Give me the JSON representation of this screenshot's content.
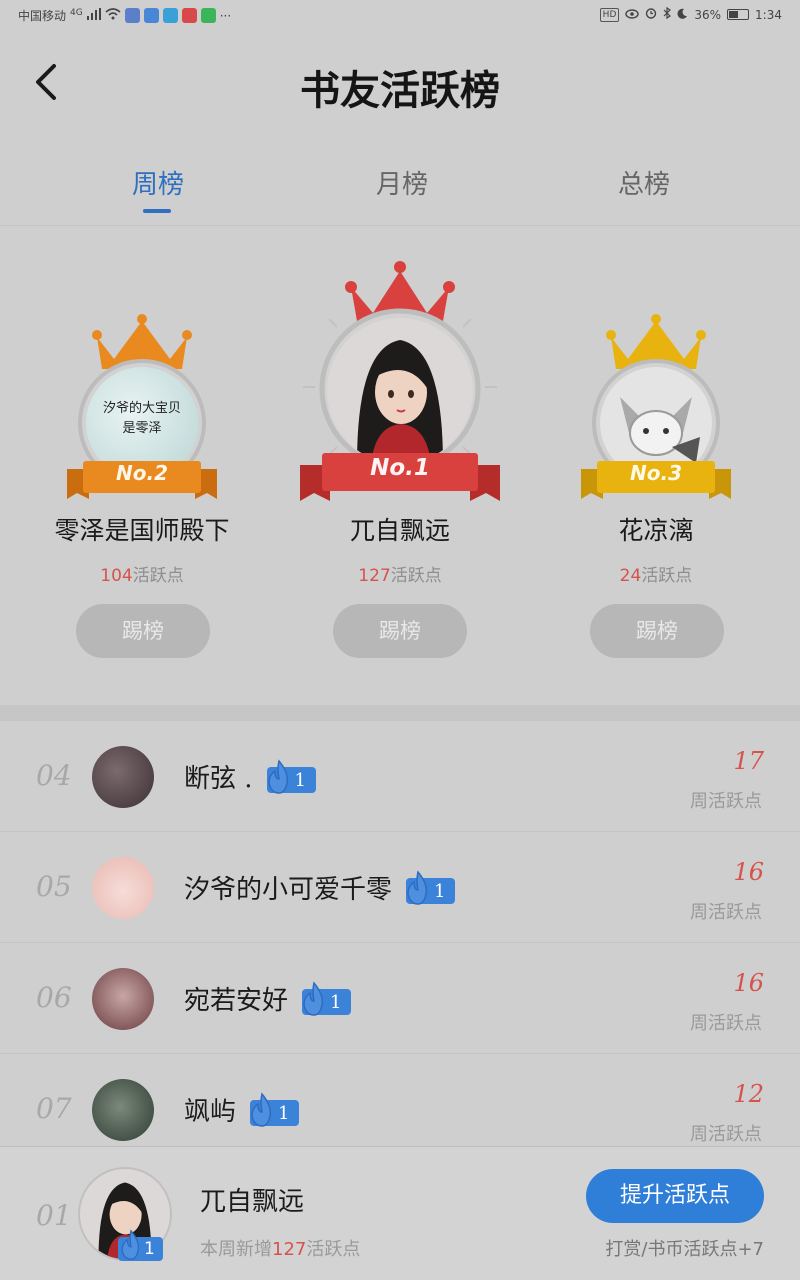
{
  "status_bar": {
    "carrier": "中国移动",
    "network": "4G",
    "more": "···",
    "hd": "HD",
    "battery": "36%",
    "time": "1:34"
  },
  "header": {
    "title": "书友活跃榜",
    "back_icon": "chevron-left-icon"
  },
  "tabs": [
    {
      "label": "周榜",
      "active": true
    },
    {
      "label": "月榜",
      "active": false
    },
    {
      "label": "总榜",
      "active": false
    }
  ],
  "podium": {
    "points_suffix": "活跃点",
    "kick_label": "踢榜",
    "first": {
      "rank_label": "No.1",
      "name": "兀自飘远",
      "points": "127"
    },
    "second": {
      "rank_label": "No.2",
      "name": "零泽是国师殿下",
      "points": "104",
      "avatar_text_1": "汐爷的大宝贝",
      "avatar_text_2": "是零泽"
    },
    "third": {
      "rank_label": "No.3",
      "name": "花凉漓",
      "points": "24"
    }
  },
  "list": {
    "score_label": "周活跃点",
    "rows": [
      {
        "rank": "04",
        "name": "断弦 .",
        "badge": "1",
        "score": "17"
      },
      {
        "rank": "05",
        "name": "汐爷的小可爱千零",
        "badge": "1",
        "score": "16"
      },
      {
        "rank": "06",
        "name": "宛若安好",
        "badge": "1",
        "score": "16"
      },
      {
        "rank": "07",
        "name": "飒屿",
        "badge": "1",
        "score": "12"
      }
    ]
  },
  "self": {
    "rank": "01",
    "name": "兀自飘远",
    "badge": "1",
    "sub_prefix": "本周新增",
    "sub_points": "127",
    "sub_suffix": "活跃点",
    "button_label": "提升活跃点",
    "reward_text": "打赏/书币活跃点+7"
  },
  "colors": {
    "accent_blue": "#2f6fc0",
    "points_red": "#d6534d",
    "gold_no1": "#d9413f",
    "orange_no2": "#e88a1f",
    "yellow_no3": "#e8b30f"
  }
}
